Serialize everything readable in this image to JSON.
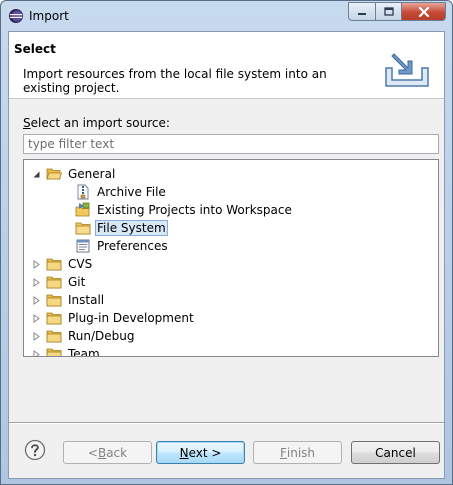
{
  "window": {
    "title": "Import"
  },
  "header": {
    "title": "Select",
    "description": "Import resources from the local file system into an existing project."
  },
  "source": {
    "label_mnemonic": "S",
    "label_rest": "elect an import source:",
    "filter_placeholder": "type filter text"
  },
  "tree": {
    "items": [
      {
        "label": "General",
        "expanded": true,
        "icon": "folder-open-icon"
      },
      {
        "label": "Archive File",
        "icon": "archive-file-icon"
      },
      {
        "label": "Existing Projects into Workspace",
        "icon": "existing-projects-icon"
      },
      {
        "label": "File System",
        "icon": "folder-icon",
        "selected": true
      },
      {
        "label": "Preferences",
        "icon": "preferences-icon"
      },
      {
        "label": "CVS",
        "icon": "folder-icon"
      },
      {
        "label": "Git",
        "icon": "folder-icon"
      },
      {
        "label": "Install",
        "icon": "folder-icon"
      },
      {
        "label": "Plug-in Development",
        "icon": "folder-icon"
      },
      {
        "label": "Run/Debug",
        "icon": "folder-icon"
      },
      {
        "label": "Team",
        "icon": "folder-icon"
      }
    ]
  },
  "buttons": {
    "back_prefix": "< ",
    "back_mnemonic": "B",
    "back_rest": "ack",
    "next_mnemonic": "N",
    "next_rest": "ext >",
    "finish_mnemonic": "F",
    "finish_rest": "inish",
    "cancel": "Cancel"
  },
  "colors": {
    "selection": "#d8e8f8",
    "selection_border": "#84acdd",
    "close_red": "#c74a36",
    "folder_yellow": "#f2c95c"
  }
}
